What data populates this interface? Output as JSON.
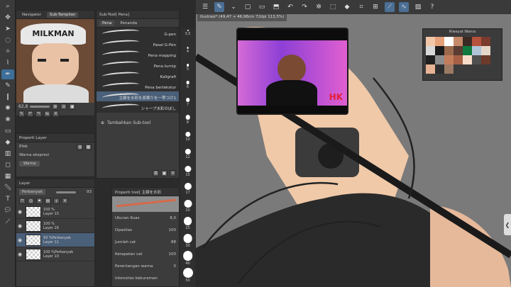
{
  "left_tools": [
    "zoom-icon",
    "move-icon",
    "pointer-icon",
    "lasso-icon",
    "wand-icon",
    "eyedropper-icon",
    "pen-icon",
    "pencil-icon",
    "brush-icon",
    "airbrush-icon",
    "decoration-icon",
    "eraser-icon",
    "fill-icon",
    "gradient-icon",
    "figure-icon",
    "frame-icon",
    "ruler-icon",
    "text-icon",
    "balloon-icon",
    "correct-line-icon"
  ],
  "navigator": {
    "tab1": "Navigator",
    "tab2": "Sub-Tampilan",
    "character_text": "MILKMAN",
    "zoom": "62,8",
    "angle": "0,0"
  },
  "subtool": {
    "header": "Sub-Tool[ Pena]",
    "tab_pen": "Pena",
    "tab_marker": "Penanda",
    "brushes": [
      "G-pen",
      "Pasal G-Pen",
      "Pena mapping",
      "Pena turnip",
      "Kaligrafi",
      "Pena bertekstur",
      "主線を水彩を原案りを一帯つけ1",
      "シャープ水彩のぼし"
    ],
    "add_label": "Tambahkan Sub-tool"
  },
  "properti_layer": {
    "header": "Properti Layer",
    "efek": "Efek",
    "ekspresi": "Warna ekspresi",
    "warna": "Warna"
  },
  "layer": {
    "header": "Layer",
    "blend": "Perbanyak",
    "opacity": "93",
    "items": [
      {
        "pct": "100 %",
        "name": "Layer 15"
      },
      {
        "pct": "100 %",
        "name": "Layer 16"
      },
      {
        "pct": "93 %Perbanyak",
        "name": "Layer 11"
      },
      {
        "pct": "100 %Perbanyak",
        "name": "Layer 10"
      }
    ]
  },
  "tool_property": {
    "header": "Properti tool[ 主線を水彩",
    "rows": [
      {
        "label": "Ukuran Kuas",
        "value": "8,0"
      },
      {
        "label": "Opasitas",
        "value": "100"
      },
      {
        "label": "Jumlah cat",
        "value": "88"
      },
      {
        "label": "Kerapatan cat",
        "value": "100"
      },
      {
        "label": "Perentangan warna",
        "value": "0"
      },
      {
        "label": "Intensitas keburaman",
        "value": ""
      }
    ]
  },
  "brush_sizes": [
    "3,5",
    "4",
    "5",
    "6",
    "7",
    "8",
    "10",
    "12",
    "15",
    "17",
    "20",
    "25",
    "30",
    "40",
    "50"
  ],
  "document": {
    "title": "Ilustrasi* (49,47 + 46,98cm 72dpi 113,5%)"
  },
  "webcam": {
    "logo": "HK"
  },
  "history": {
    "title": "Riwayat Warna",
    "colors": [
      "#f2c6a8",
      "#e6a17a",
      "#ffffff",
      "#c58a6a",
      "#3a2a24",
      "#b5513c",
      "#7a3b2e",
      "#d9d9d9",
      "#1c1c1c",
      "#9b6a4d",
      "#5a3c32",
      "#0f7a3e",
      "#b0c4d8",
      "#e4d6c8",
      "#202020",
      "#8d8d8d",
      "#c47d5b",
      "#a56045",
      "#f7ddc9",
      "#4f4f4f",
      "#6b3a2a",
      "#e8b395",
      "#2e2e2e",
      "#9c7a64"
    ]
  },
  "colors": {
    "accent": "#4b6f95",
    "canvas": "#7a7a7a"
  }
}
